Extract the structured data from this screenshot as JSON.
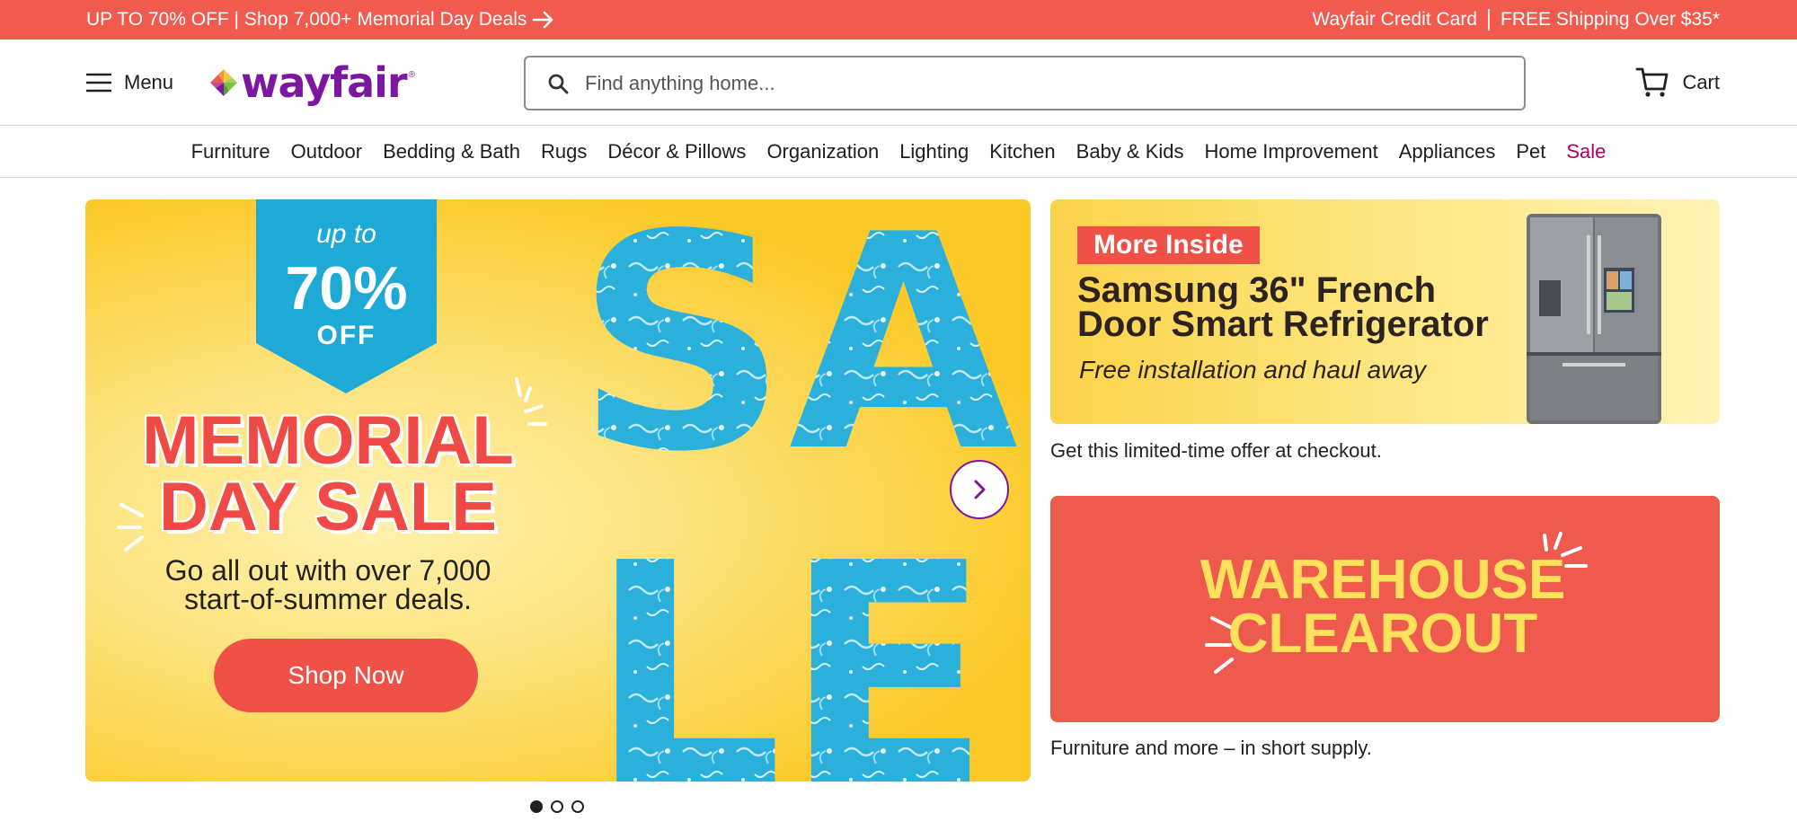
{
  "promo": {
    "left_text": "UP TO 70% OFF | Shop 7,000+ Memorial Day Deals",
    "credit_card": "Wayfair Credit Card",
    "shipping": "FREE Shipping Over $35*"
  },
  "header": {
    "menu_label": "Menu",
    "logo_text": "wayfair",
    "logo_reg": "®",
    "search_placeholder": "Find anything home...",
    "cart_label": "Cart"
  },
  "categories": [
    "Furniture",
    "Outdoor",
    "Bedding & Bath",
    "Rugs",
    "Décor & Pillows",
    "Organization",
    "Lighting",
    "Kitchen",
    "Baby & Kids",
    "Home Improvement",
    "Appliances",
    "Pet",
    "Sale"
  ],
  "hero": {
    "ribbon_up_to": "up to",
    "ribbon_percent": "70%",
    "ribbon_off": "OFF",
    "title_line1": "MEMORIAL",
    "title_line2": "DAY SALE",
    "subtitle_line1": "Go all out with over 7,000",
    "subtitle_line2": "start-of-summer deals.",
    "cta": "Shop Now",
    "sale_letters": "SALE",
    "active_slide": 1,
    "slide_count": 3
  },
  "samsung": {
    "badge": "More Inside",
    "title_line1": "Samsung 36\" French",
    "title_line2": "Door Smart Refrigerator",
    "subtitle": "Free installation and haul away",
    "caption": "Get this limited-time offer at checkout."
  },
  "warehouse": {
    "title_line1": "WAREHOUSE",
    "title_line2": "CLEAROUT",
    "caption": "Furniture and more – in short supply."
  },
  "colors": {
    "promo_bg": "#f05a4f",
    "brand_purple": "#7b189f",
    "sale_red": "#b4005a",
    "hero_yellow": "#fbc928",
    "pool_blue": "#2bb0dc",
    "cta_red": "#ef5147",
    "warehouse_yellow": "#fde15a"
  }
}
